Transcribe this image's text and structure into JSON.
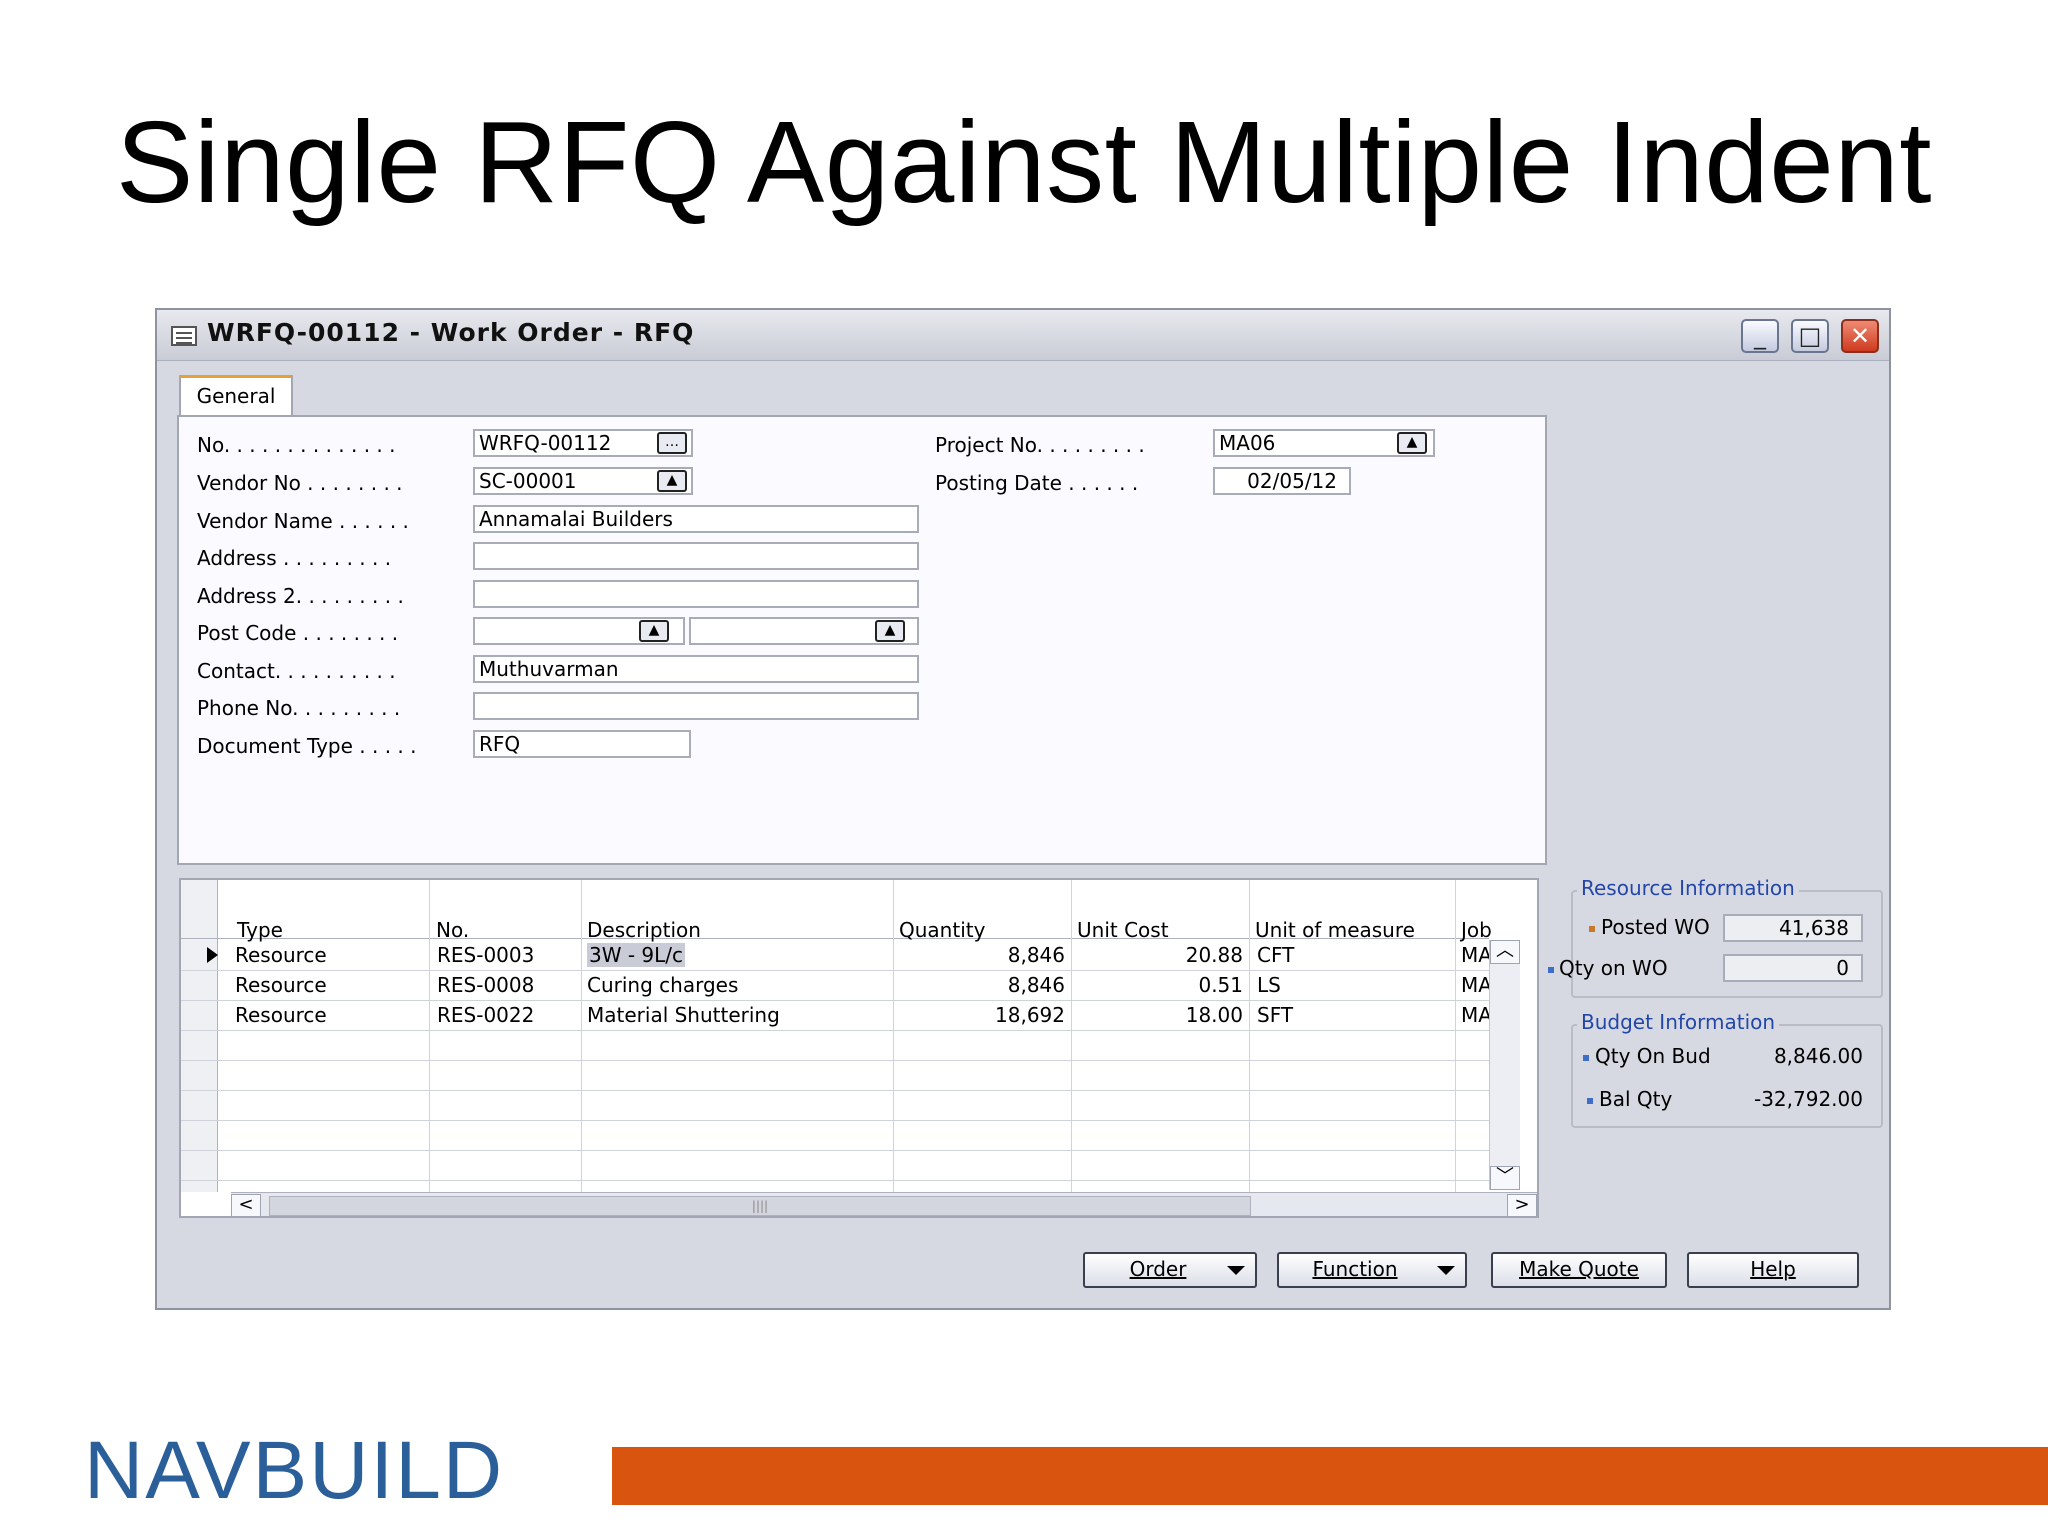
{
  "slide": {
    "title": "Single RFQ Against Multiple Indent",
    "logo_text": "NAVBUILD",
    "accent_color": "#d9550f"
  },
  "window": {
    "title": "WRFQ-00112 - Work Order - RFQ",
    "controls": [
      "minimize",
      "maximize",
      "close"
    ]
  },
  "tabs": [
    "General"
  ],
  "general": {
    "no_label": "No. . . . . . . . . . . . . .",
    "no_value": "WRFQ-00112",
    "vendor_no_label": "Vendor No . . . . . . . .",
    "vendor_no_value": "SC-00001",
    "vendor_name_label": "Vendor Name . . . . . .",
    "vendor_name_value": "Annamalai Builders",
    "address_label": "Address . . . . . . . . .",
    "address_value": "",
    "address2_label": "Address 2. . . . . . . . .",
    "address2_value": "",
    "post_code_label": "Post Code . . . . . . . .",
    "post_code_value": "",
    "post_city_value": "",
    "contact_label": "Contact. . . . . . . . . .",
    "contact_value": "Muthuvarman",
    "phone_label": "Phone No. . . . . . . . .",
    "phone_value": "",
    "doc_type_label": "Document Type . . . . .",
    "doc_type_value": "RFQ",
    "project_label": "Project No. . . . . . . . .",
    "project_value": "MA06",
    "posting_label": "Posting Date . . . . . .",
    "posting_value": "02/05/12"
  },
  "lines": {
    "headers": [
      "Type",
      "No.",
      "Description",
      "Quantity",
      "Unit Cost",
      "Unit of measure",
      "Job"
    ],
    "rows": [
      {
        "type": "Resource",
        "no": "RES-0003",
        "desc": "3W - 9L/c",
        "qty": "8,846",
        "cost": "20.88",
        "uom": "CFT",
        "job": "MAC"
      },
      {
        "type": "Resource",
        "no": "RES-0008",
        "desc": "Curing charges",
        "qty": "8,846",
        "cost": "0.51",
        "uom": "LS",
        "job": "MAC"
      },
      {
        "type": "Resource",
        "no": "RES-0022",
        "desc": "Material Shuttering",
        "qty": "18,692",
        "cost": "18.00",
        "uom": "SFT",
        "job": "MAC"
      }
    ]
  },
  "resource_info": {
    "title": "Resource Information",
    "posted_wo_label": "Posted WO",
    "posted_wo_value": "41,638",
    "qty_on_wo_label": "Qty on WO",
    "qty_on_wo_value": "0"
  },
  "budget_info": {
    "title": "Budget  Information",
    "qty_on_bud_label": "Qty On Bud",
    "qty_on_bud_value": "8,846.00",
    "bal_qty_label": "Bal Qty",
    "bal_qty_value": "-32,792.00"
  },
  "buttons": {
    "order": "Order",
    "function": "Function",
    "make_quote": "Make Quote",
    "help": "Help"
  }
}
